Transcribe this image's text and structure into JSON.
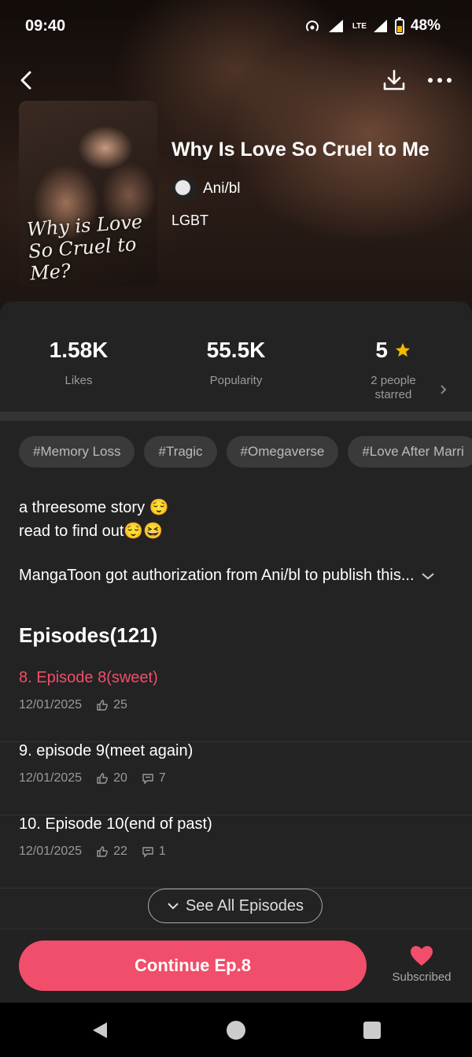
{
  "status": {
    "time": "09:40",
    "battery": "48%",
    "network": "LTE"
  },
  "manga": {
    "title": "Why Is Love So Cruel to Me",
    "cover_title": "Why is Love So Cruel to Me?",
    "author": "Ani/bl",
    "genre": "LGBT"
  },
  "stats": {
    "likes_value": "1.58K",
    "likes_label": "Likes",
    "popularity_value": "55.5K",
    "popularity_label": "Popularity",
    "rating_value": "5",
    "rating_label": "2 people starred"
  },
  "tags": [
    "#Memory Loss",
    "#Tragic",
    "#Omegaverse",
    "#Love After Marri"
  ],
  "description": {
    "line1": "a threesome story 😌",
    "line2": "read to find out😌😆",
    "authorization": "MangaToon got authorization from Ani/bl to publish this..."
  },
  "episodes": {
    "header": "Episodes(121)",
    "items": [
      {
        "title": "8. Episode 8(sweet)",
        "date": "12/01/2025",
        "likes": "25",
        "comments": ""
      },
      {
        "title": "9. episode 9(meet again)",
        "date": "12/01/2025",
        "likes": "20",
        "comments": "7"
      },
      {
        "title": "10. Episode 10(end of past)",
        "date": "12/01/2025",
        "likes": "22",
        "comments": "1"
      }
    ],
    "see_all": "See All Episodes"
  },
  "bottom": {
    "continue": "Continue Ep.8",
    "subscribed": "Subscribed"
  },
  "colors": {
    "accent": "#f04e6a",
    "star": "#f5b800",
    "background": "#232323"
  },
  "icons": [
    "back-icon",
    "download-icon",
    "more-icon",
    "star-icon",
    "chevron-right-icon",
    "chevron-down-icon",
    "thumb-up-icon",
    "comment-icon",
    "heart-icon"
  ]
}
